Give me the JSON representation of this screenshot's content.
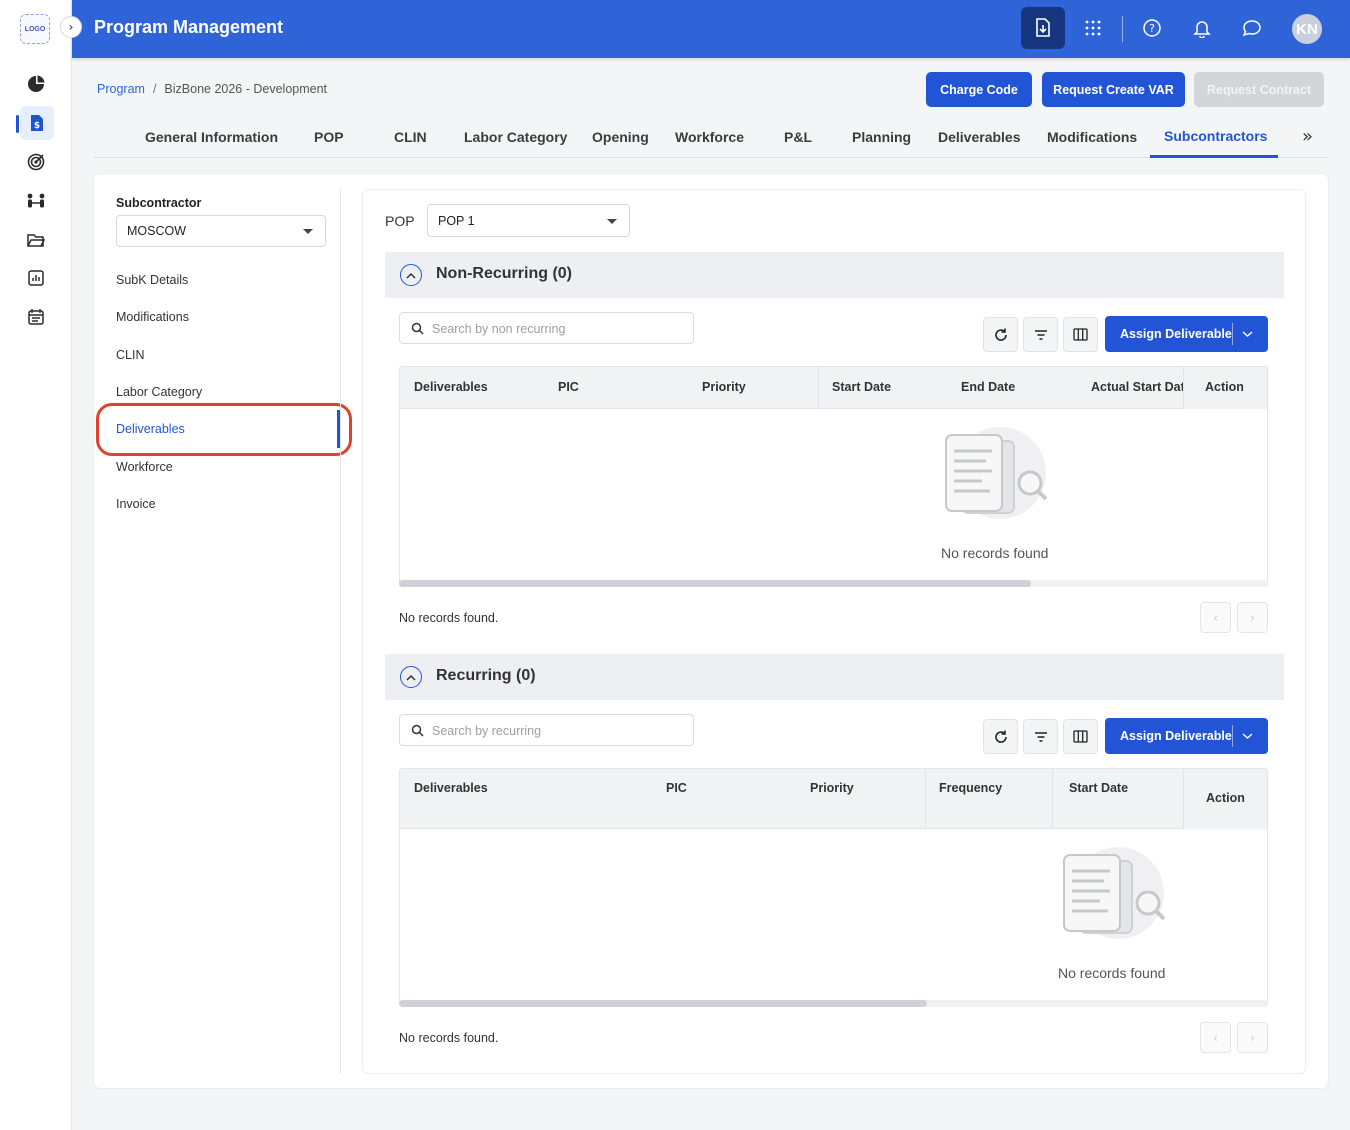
{
  "app": {
    "logo_text": "LOGO",
    "title": "Program Management",
    "user_initials": "KN",
    "colors": {
      "brand": "#2f63d8",
      "accent": "#2255d6",
      "highlight": "#e0412e"
    }
  },
  "rail": {
    "icons": [
      "pie-chart-icon",
      "dollar-document-icon",
      "target-icon",
      "people-icon",
      "folder-icon",
      "bar-chart-icon",
      "calendar-icon"
    ],
    "active": "dollar-document-icon"
  },
  "header": {
    "icons": [
      "download-document-icon",
      "apps-grid-icon",
      "help-icon",
      "bell-icon",
      "chat-icon"
    ]
  },
  "breadcrumb": {
    "root": "Program",
    "separator": "/",
    "current": "BizBone 2026 - Development"
  },
  "actions": {
    "charge_code": "Charge Code",
    "request_var": "Request Create VAR",
    "request_contract": "Request Contract"
  },
  "tabs": {
    "items": [
      "General Information",
      "POP",
      "CLIN",
      "Labor Category",
      "Opening",
      "Workforce",
      "P&L",
      "Planning",
      "Deliverables",
      "Modifications",
      "Subcontractors"
    ],
    "active": "Subcontractors",
    "more": "»"
  },
  "sidebar": {
    "subcontractor_label": "Subcontractor",
    "subcontractor_value": "MOSCOW",
    "items": [
      "SubK Details",
      "Modifications",
      "CLIN",
      "Labor Category",
      "Deliverables",
      "Workforce",
      "Invoice"
    ],
    "active": "Deliverables"
  },
  "pop": {
    "label": "POP",
    "value": "POP 1"
  },
  "non_recurring": {
    "title": "Non-Recurring (0)",
    "search_placeholder": "Search by non recurring",
    "assign_label": "Assign Deliverable",
    "columns": [
      "Deliverables",
      "PIC",
      "Priority",
      "Start Date",
      "End Date",
      "Actual Start Dat"
    ],
    "action_column": "Action",
    "empty_text": "No records found",
    "footer": "No records found."
  },
  "recurring": {
    "title": "Recurring (0)",
    "search_placeholder": "Search by recurring",
    "assign_label": "Assign Deliverable",
    "columns": [
      "Deliverables",
      "PIC",
      "Priority",
      "Frequency",
      "Start Date"
    ],
    "action_column": "Action",
    "empty_text": "No records found",
    "footer": "No records found."
  }
}
